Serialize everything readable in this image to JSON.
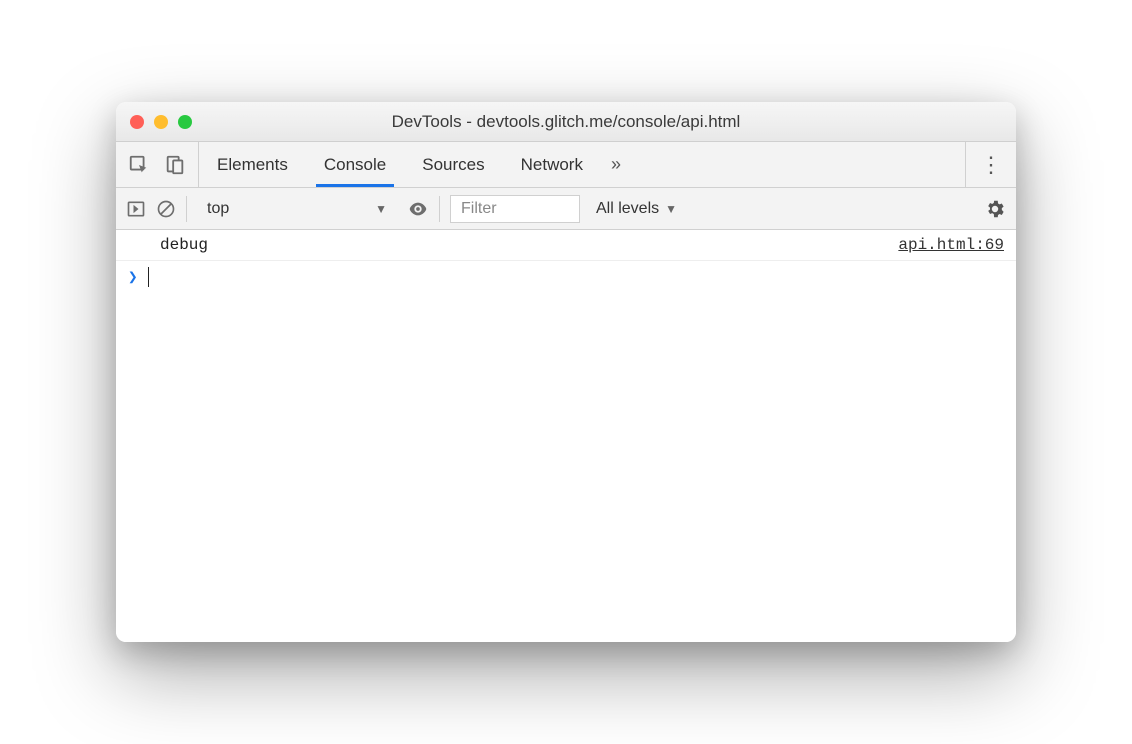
{
  "window": {
    "title": "DevTools - devtools.glitch.me/console/api.html"
  },
  "tabs": {
    "items": [
      {
        "label": "Elements",
        "active": false
      },
      {
        "label": "Console",
        "active": true
      },
      {
        "label": "Sources",
        "active": false
      },
      {
        "label": "Network",
        "active": false
      }
    ],
    "overflow": "»"
  },
  "toolbar": {
    "context": "top",
    "filter_placeholder": "Filter",
    "levels_label": "All levels"
  },
  "console": {
    "logs": [
      {
        "message": "debug",
        "source": "api.html:69"
      }
    ],
    "prompt": "❯"
  }
}
